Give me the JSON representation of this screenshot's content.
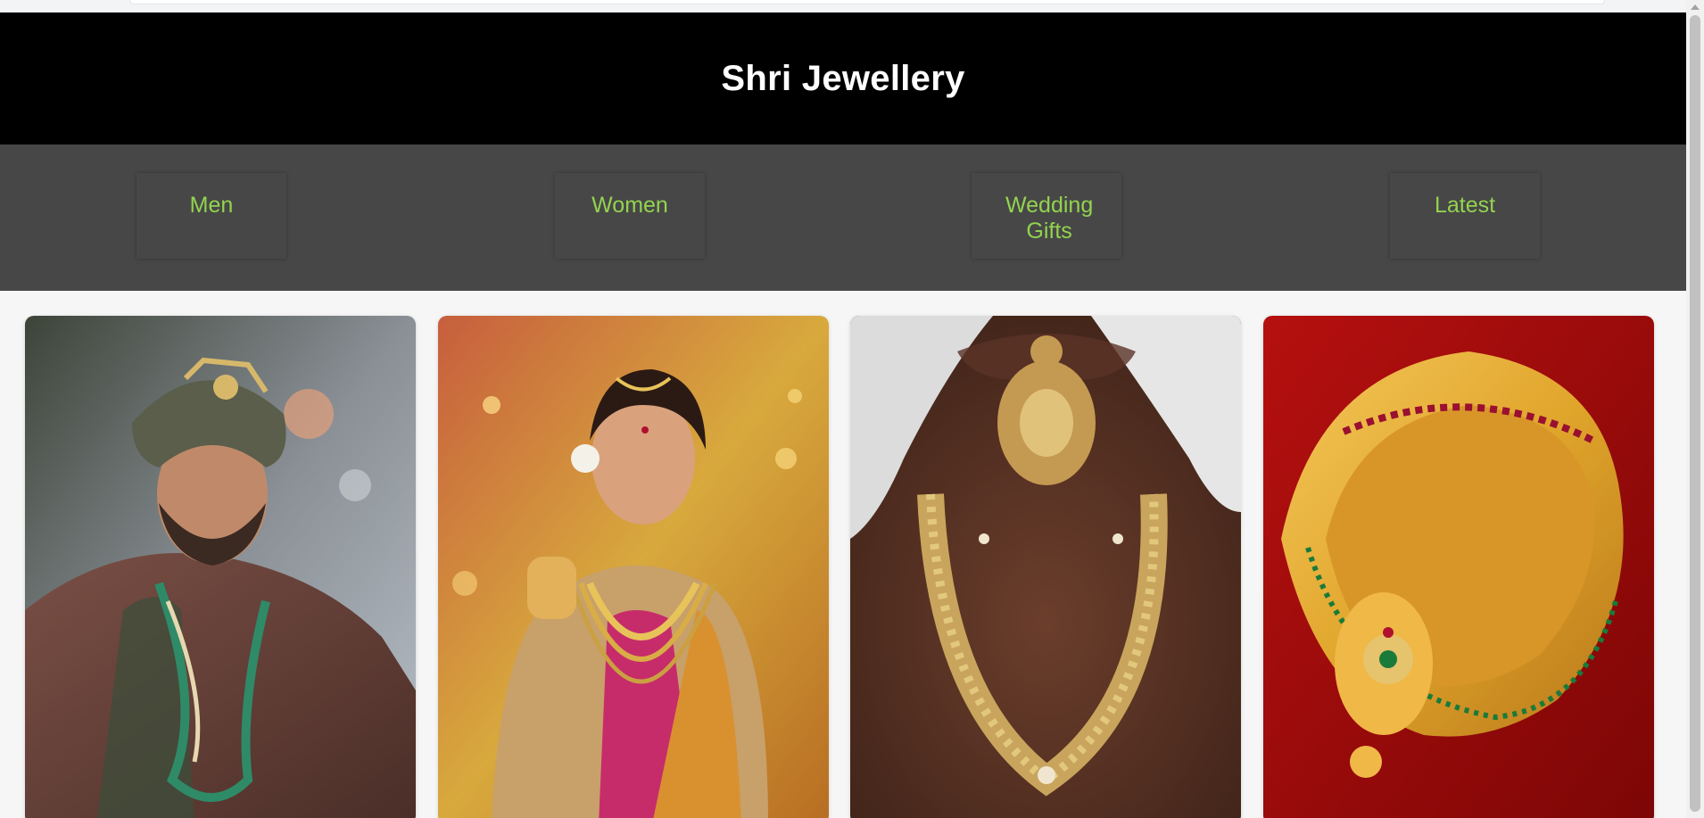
{
  "site": {
    "title": "Shri Jewellery"
  },
  "nav": {
    "items": [
      {
        "label": "Men"
      },
      {
        "label": "Women"
      },
      {
        "label": "Wedding Gifts"
      },
      {
        "label": "Latest"
      }
    ]
  },
  "gallery": {
    "cards": [
      {
        "subject": "groom-jewellery-photo"
      },
      {
        "subject": "bride-jewellery-photo"
      },
      {
        "subject": "antique-gold-necklace-photo"
      },
      {
        "subject": "gold-choker-photo"
      }
    ]
  },
  "colors": {
    "header_bg": "#000000",
    "nav_bg": "#474747",
    "nav_text": "#93d34f",
    "page_bg": "#f6f6f6"
  }
}
